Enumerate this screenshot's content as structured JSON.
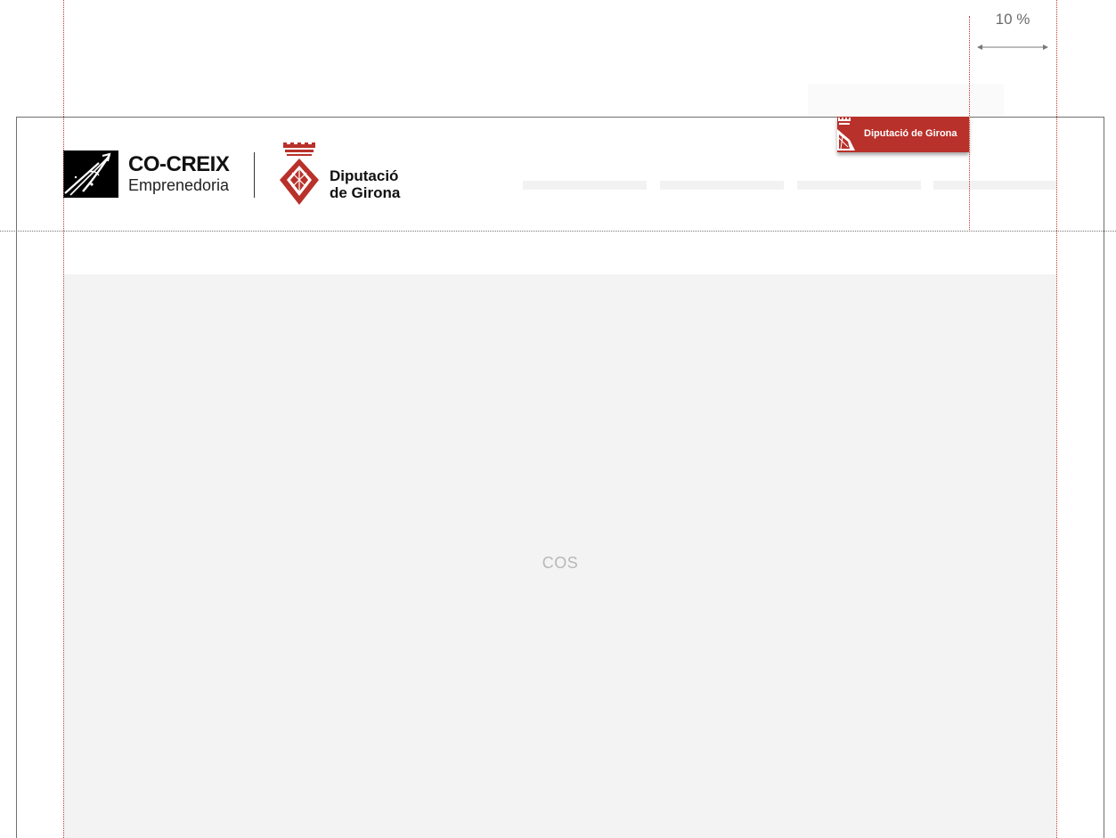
{
  "measure": {
    "label": "10 %"
  },
  "header": {
    "cocreix": {
      "name": "CO-CREIX",
      "subtitle": "Emprenedoria",
      "icon": "arrow-stroke-logo-icon"
    },
    "diputacio": {
      "line1": "Diputació",
      "line2": "de Girona",
      "icon": "crowned-crest-icon"
    },
    "ribbon": {
      "label": "Diputació de Girona",
      "color": "#b8312a"
    },
    "nav_placeholders": 4
  },
  "body": {
    "label": "COS",
    "background": "#f3f3f3"
  },
  "colors": {
    "guide_vertical": "#c0392b",
    "guide_horizontal": "#777777",
    "frame_border": "#6f6f6f",
    "brand_red": "#b8312a"
  }
}
